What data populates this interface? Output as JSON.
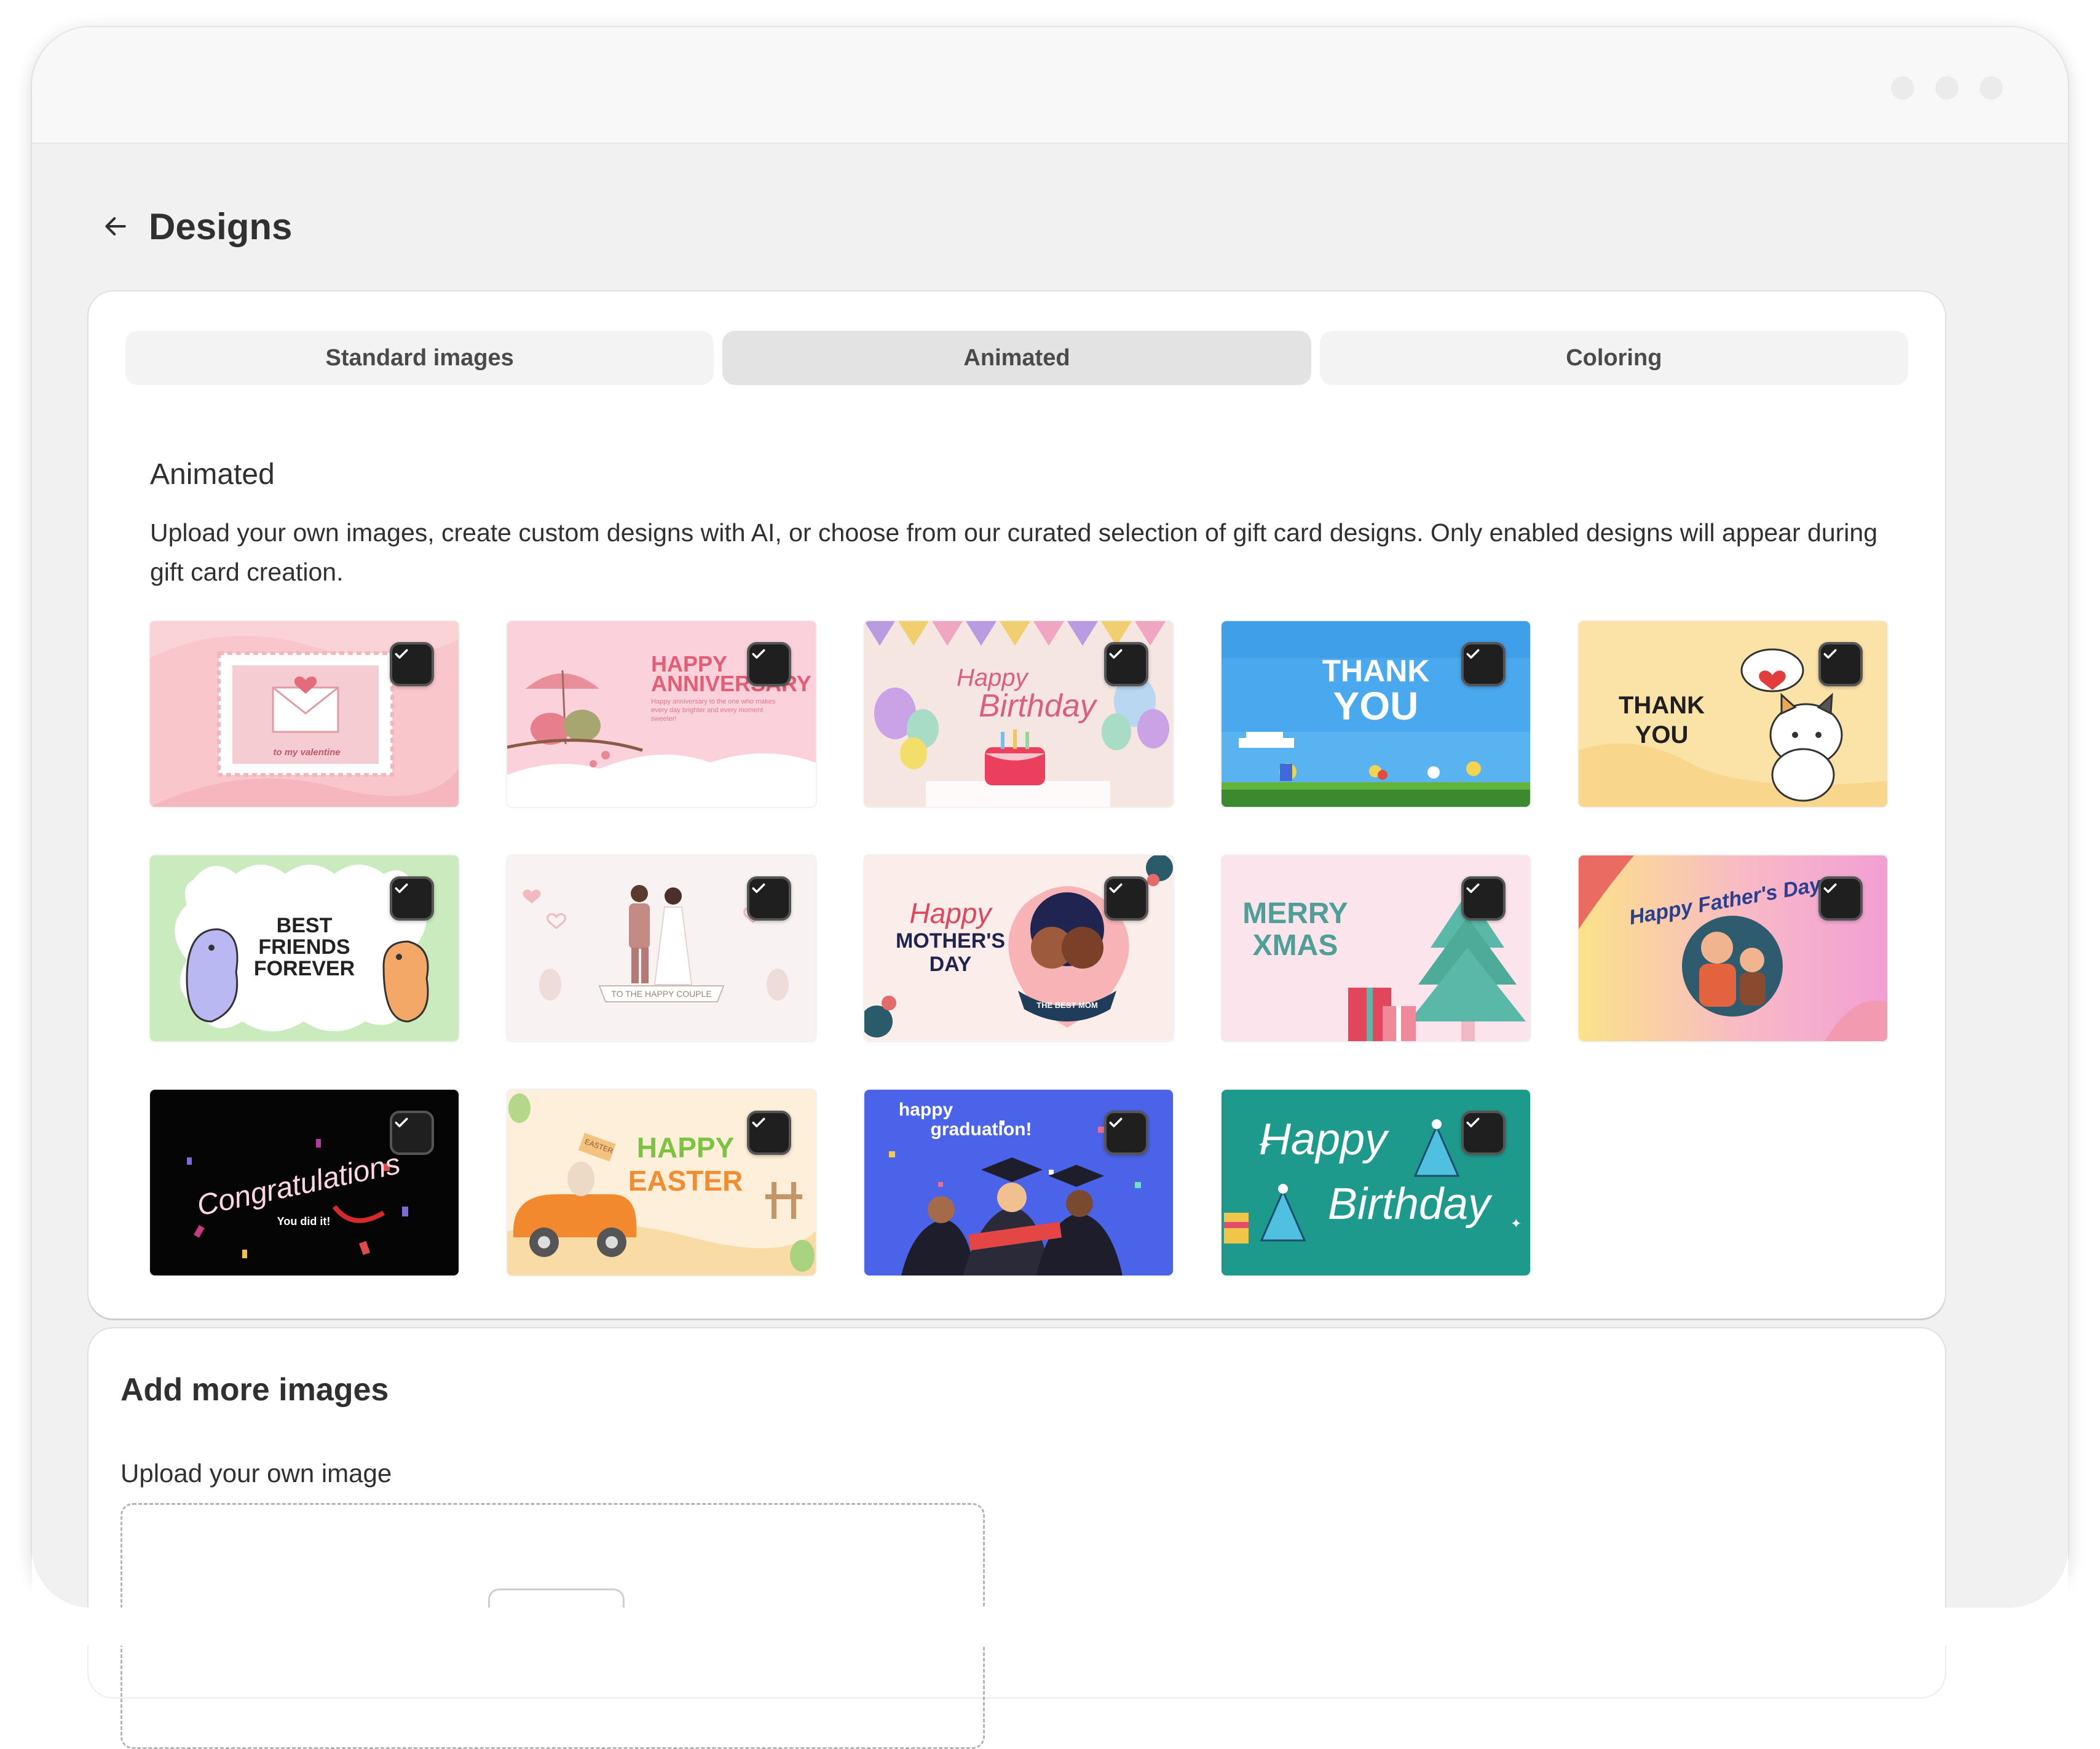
{
  "window": {
    "controls": [
      "window-dot",
      "window-dot",
      "window-dot"
    ]
  },
  "header": {
    "back_icon": "arrow-left-icon",
    "title": "Designs"
  },
  "tabs": [
    {
      "label": "Standard images",
      "active": false
    },
    {
      "label": "Animated",
      "active": true
    },
    {
      "label": "Coloring",
      "active": false
    }
  ],
  "section": {
    "title": "Animated",
    "description": "Upload your own images, create custom designs with AI, or choose from our curated selection of gift card designs. Only enabled designs will appear during gift card creation."
  },
  "designs": [
    {
      "id": "valentine",
      "enabled": true,
      "texts": [
        "to my valentine"
      ]
    },
    {
      "id": "anniversary",
      "enabled": true,
      "texts": [
        "HAPPY",
        "ANNIVERSARY",
        "Happy anniversary to the one who makes",
        "every day brighter and every moment",
        "sweeter!"
      ]
    },
    {
      "id": "birthday-party",
      "enabled": true,
      "texts": [
        "Happy",
        "Birthday"
      ]
    },
    {
      "id": "thank-you-pixel",
      "enabled": true,
      "texts": [
        "THANK",
        "YOU"
      ]
    },
    {
      "id": "thank-you-cat",
      "enabled": true,
      "texts": [
        "THANK",
        "YOU"
      ]
    },
    {
      "id": "best-friends",
      "enabled": true,
      "texts": [
        "BEST",
        "FRIENDS",
        "FOREVER"
      ]
    },
    {
      "id": "wedding",
      "enabled": true,
      "texts": [
        "TO THE HAPPY COUPLE"
      ]
    },
    {
      "id": "mothers-day",
      "enabled": true,
      "texts": [
        "Happy",
        "MOTHER'S",
        "DAY",
        "THE BEST MOM"
      ]
    },
    {
      "id": "merry-xmas",
      "enabled": true,
      "texts": [
        "MERRY",
        "XMAS"
      ]
    },
    {
      "id": "fathers-day",
      "enabled": true,
      "texts": [
        "Happy Father's Day"
      ]
    },
    {
      "id": "congratulations",
      "enabled": true,
      "texts": [
        "Congratulations",
        "You did it!"
      ]
    },
    {
      "id": "easter",
      "enabled": true,
      "texts": [
        "HAPPY",
        "EASTER",
        "EASTER"
      ]
    },
    {
      "id": "graduation",
      "enabled": true,
      "texts": [
        "happy",
        "graduation!"
      ]
    },
    {
      "id": "birthday-teal",
      "enabled": true,
      "texts": [
        "Happy",
        "Birthday"
      ]
    }
  ],
  "check_icon": "checkmark-icon",
  "add_more": {
    "title": "Add more images",
    "upload_label": "Upload your own image"
  }
}
